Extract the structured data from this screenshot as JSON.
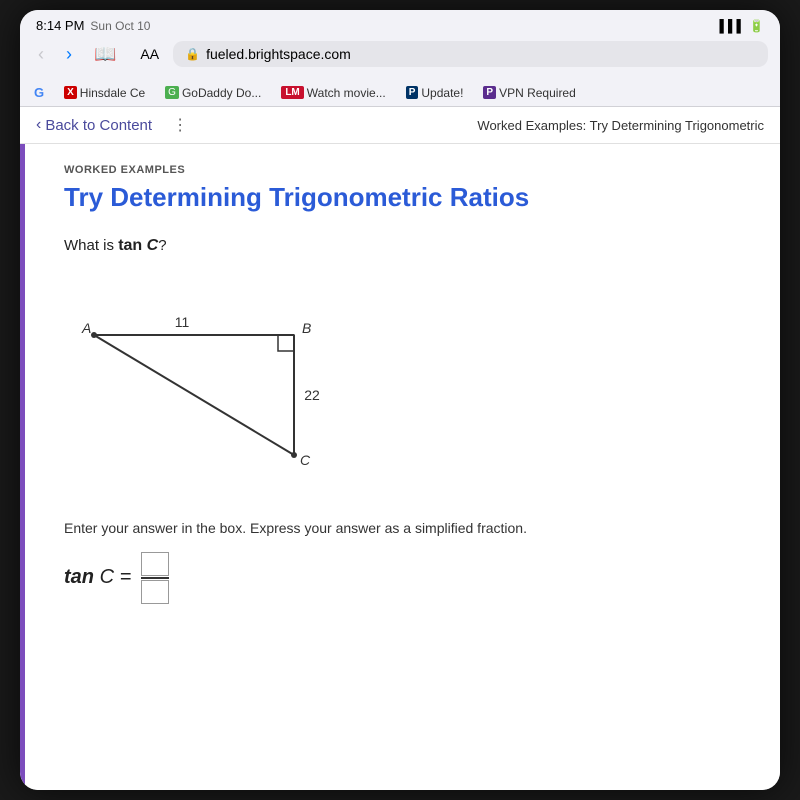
{
  "status_bar": {
    "time": "8:14 PM",
    "day": "Sun Oct 10",
    "url": "fueled.brightspace.com",
    "lock_icon": "🔒"
  },
  "browser": {
    "address": "fueled.brightspace.com",
    "aa_label": "AA"
  },
  "bookmarks": [
    {
      "id": "google",
      "icon": "G",
      "label": ""
    },
    {
      "id": "hinsdale",
      "icon": "X",
      "label": "Hinsdale Ce"
    },
    {
      "id": "godaddy",
      "icon": "G",
      "label": "GoDaddy Do..."
    },
    {
      "id": "watch",
      "icon": "LM",
      "label": "Watch movie..."
    },
    {
      "id": "update",
      "icon": "P",
      "label": "Update!"
    },
    {
      "id": "vpn",
      "icon": "P",
      "label": "VPN Required"
    }
  ],
  "page_header": {
    "back_label": "Back to Content",
    "title": "Worked Examples: Try Determining Trigonometric"
  },
  "content": {
    "worked_examples_label": "WORKED EXAMPLES",
    "section_title": "Try Determining Trigonometric Ratios",
    "question": "What is tan C?",
    "triangle": {
      "side_a": "A",
      "side_b": "B",
      "side_c": "C",
      "label_11": "11",
      "label_22": "22"
    },
    "instructions": "Enter your answer in the box. Express your answer as a simplified fraction.",
    "answer_label": "tan C="
  }
}
